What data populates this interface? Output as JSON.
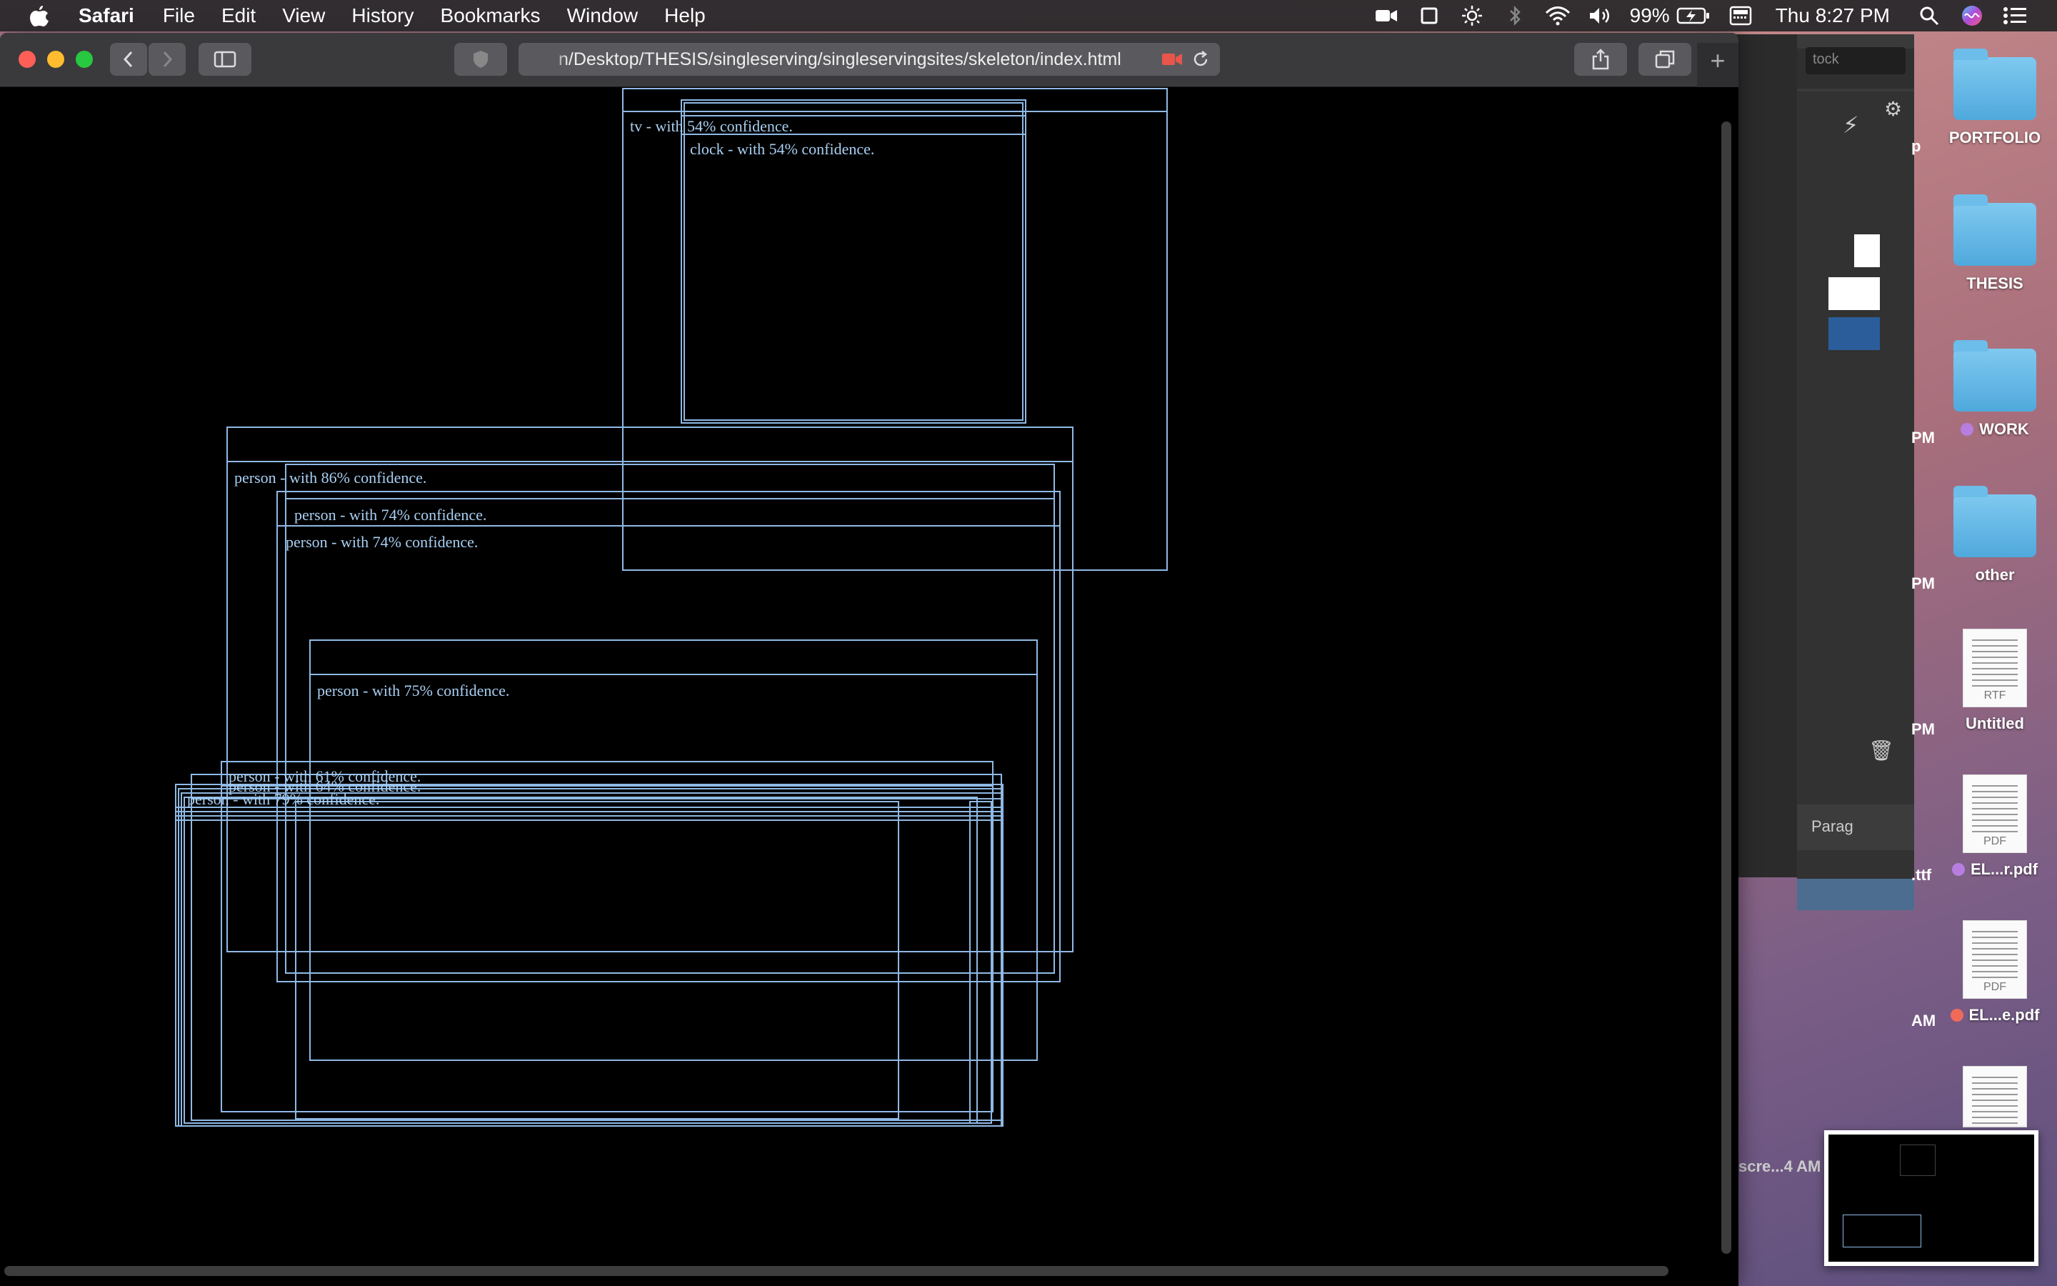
{
  "menubar": {
    "app_name": "Safari",
    "menus": [
      "File",
      "Edit",
      "View",
      "History",
      "Bookmarks",
      "Window",
      "Help"
    ],
    "battery": "99%",
    "clock": "Thu 8:27 PM",
    "icons": [
      "video-camera-icon",
      "screen-mirror-icon",
      "brightness-icon",
      "bluetooth-icon",
      "wifi-icon",
      "volume-icon",
      "battery-charging-icon",
      "keyboard-flag-icon",
      "spotlight-search-icon",
      "siri-icon",
      "notification-center-icon"
    ]
  },
  "browser": {
    "url": "n/Desktop/THESIS/singleserving/singleservingsites/skeleton/index.html",
    "buttons": [
      "back",
      "forward",
      "sidebar",
      "privacy-report",
      "record",
      "reload",
      "share",
      "tabs",
      "new-tab"
    ]
  },
  "detections": [
    {
      "label": "tv - with 54% confidence."
    },
    {
      "label": "clock - with 54% confidence."
    },
    {
      "label": "person - with 86% confidence."
    },
    {
      "label": "person - with 74% confidence."
    },
    {
      "label": "person - with 74% confidence."
    },
    {
      "label": "person - with 75% confidence."
    },
    {
      "label": "person - with 61% confidence."
    },
    {
      "label": "person - with 64% confidence."
    },
    {
      "label": "person - with 79% confidence."
    }
  ],
  "background_app": {
    "search_placeholder": "tock",
    "panel_tab": "Parag"
  },
  "desktop": {
    "icons": [
      {
        "label": "PORTFOLIO",
        "kind": "folder"
      },
      {
        "label": "THESIS",
        "kind": "folder"
      },
      {
        "label": "WORK",
        "kind": "folder",
        "tag_color": "#b77ee0"
      },
      {
        "label": "other",
        "kind": "folder"
      },
      {
        "label": "Untitled",
        "kind": "doc",
        "type": "RTF"
      },
      {
        "label": "EL...r.pdf",
        "kind": "doc",
        "type": "PDF",
        "tag_color": "#b77ee0"
      },
      {
        "label": "EL...e.pdf",
        "kind": "doc",
        "type": "PDF",
        "tag_color": "#f06a5a"
      }
    ],
    "partial_labels": [
      "p",
      "PM",
      "PM",
      "PM",
      ".ttf",
      "AM",
      "scre...4 AM"
    ]
  }
}
